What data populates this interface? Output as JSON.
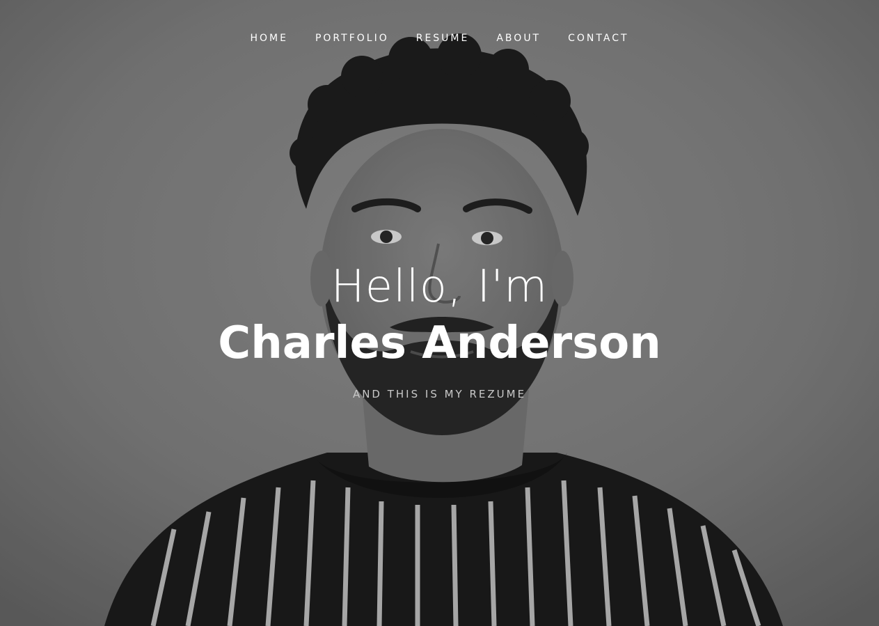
{
  "nav": {
    "items": [
      {
        "label": "HOME"
      },
      {
        "label": "PORTFOLIO"
      },
      {
        "label": "RESUME"
      },
      {
        "label": "ABOUT"
      },
      {
        "label": "CONTACT"
      }
    ]
  },
  "hero": {
    "greeting": "Hello, I'm",
    "name": "Charles Anderson",
    "tagline": "AND THIS IS MY REZUME",
    "background": "black-and-white portrait photo of a bearded man with curly hair in a striped t-shirt"
  },
  "colors": {
    "text": "#ffffff",
    "tagline": "#c9c9c9",
    "background": "#7d7d7d"
  }
}
